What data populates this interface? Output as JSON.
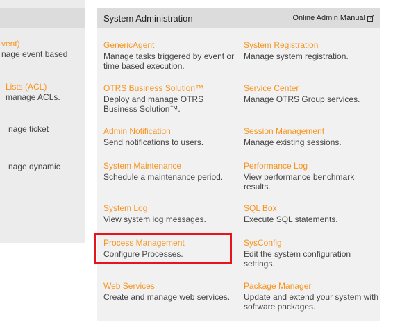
{
  "left": {
    "items": [
      {
        "title": "vent)",
        "desc": "nage event based"
      },
      {
        "title": "Lists (ACL)",
        "desc": "manage ACLs."
      },
      {
        "title": "",
        "desc": "nage ticket"
      },
      {
        "title": "",
        "desc": "nage dynamic"
      }
    ]
  },
  "header": {
    "title": "System Administration",
    "manual_label": "Online Admin Manual"
  },
  "items": [
    {
      "title": "GenericAgent",
      "desc": "Manage tasks triggered by event or time based execution."
    },
    {
      "title": "System Registration",
      "desc": "Manage system registration."
    },
    {
      "title": "OTRS Business Solution™",
      "desc": "Deploy and manage OTRS Business Solution™."
    },
    {
      "title": "Service Center",
      "desc": "Manage OTRS Group services."
    },
    {
      "title": "Admin Notification",
      "desc": "Send notifications to users."
    },
    {
      "title": "Session Management",
      "desc": "Manage existing sessions."
    },
    {
      "title": "System Maintenance",
      "desc": "Schedule a maintenance period."
    },
    {
      "title": "Performance Log",
      "desc": "View performance benchmark results."
    },
    {
      "title": "System Log",
      "desc": "View system log messages."
    },
    {
      "title": "SQL Box",
      "desc": "Execute SQL statements."
    },
    {
      "title": "Process Management",
      "desc": "Configure Processes."
    },
    {
      "title": "SysConfig",
      "desc": "Edit the system configuration settings."
    },
    {
      "title": "Web Services",
      "desc": "Create and manage web services."
    },
    {
      "title": "Package Manager",
      "desc": "Update and extend your system with software packages."
    }
  ],
  "colors": {
    "link": "#f7941d",
    "highlight": "#e8141c"
  }
}
